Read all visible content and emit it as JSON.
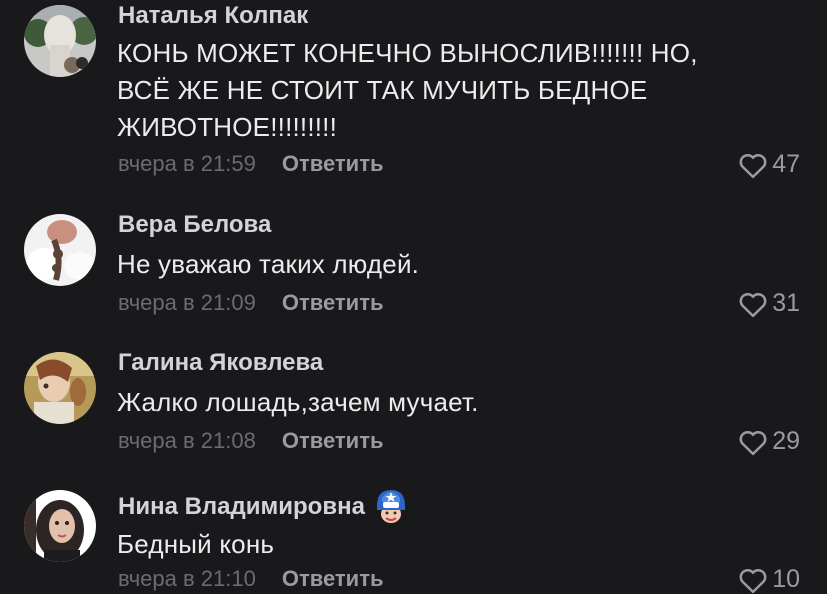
{
  "comments": [
    {
      "author": "Наталья Колпак",
      "text_lines": [
        "КОНЬ МОЖЕТ КОНЕЧНО ВЫНОСЛИВ!!!!!!! НО,",
        "ВСЁ ЖЕ НЕ СТОИТ ТАК МУЧИТЬ БЕДНОЕ",
        "ЖИВОТНОЕ!!!!!!!!!"
      ],
      "time": "вчера в 21:59",
      "reply_label": "Ответить",
      "likes": "47"
    },
    {
      "author": "Вера Белова",
      "text_lines": [
        "Не уважаю таких людей."
      ],
      "time": "вчера в 21:09",
      "reply_label": "Ответить",
      "likes": "31"
    },
    {
      "author": "Галина Яковлева",
      "text_lines": [
        "Жалко лошадь,зачем мучает."
      ],
      "time": "вчера в 21:08",
      "reply_label": "Ответить",
      "likes": "29"
    },
    {
      "author": "Нина Владимировна",
      "text_lines": [
        "Бедный конь"
      ],
      "time": "вчера в 21:10",
      "reply_label": "Ответить",
      "likes": "10",
      "badge_icon": "captain-shield-icon"
    }
  ],
  "colors": {
    "background": "#19191b",
    "author": "#d4d4d8",
    "text": "#ececee",
    "meta": "#6b6b70",
    "action": "#9a9aa0"
  }
}
